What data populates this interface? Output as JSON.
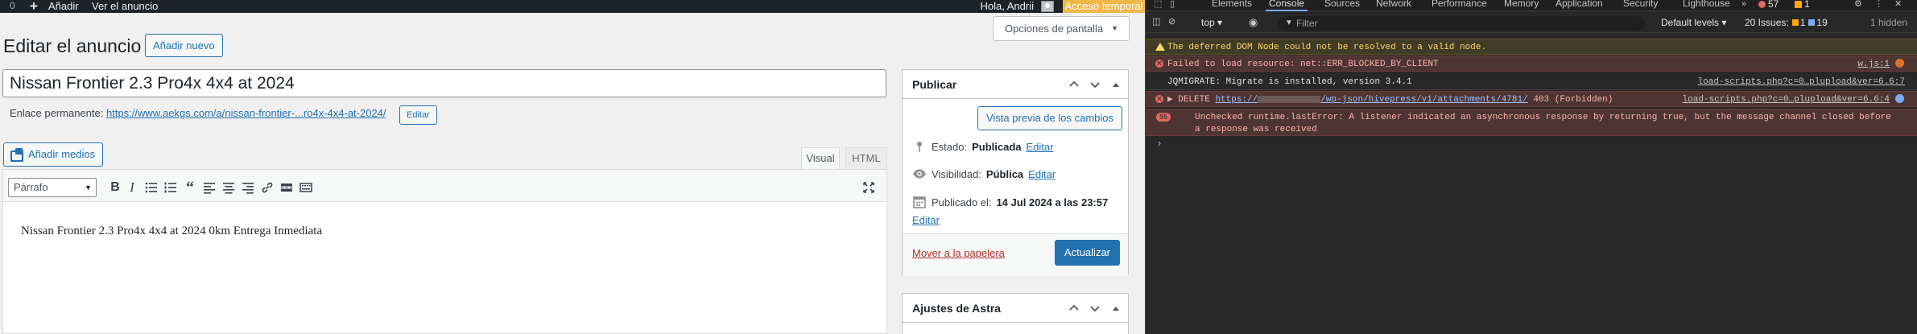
{
  "adminbar": {
    "count": "0",
    "new_label": "Añadir",
    "view_label": "Ver el anuncio",
    "howdy": "Hola, Andrii",
    "temp_access": "Acceso temporal"
  },
  "screen_options": "Opciones de pantalla",
  "page": {
    "title": "Editar el anuncio",
    "add_new": "Añadir nuevo",
    "post_title": "Nissan Frontier 2.3 Pro4x 4x4 at 2024",
    "permalink_label": "Enlace permanente:",
    "permalink_url": "https://www.aekgs.com/a/nissan-frontier-...ro4x-4x4-at-2024/",
    "permalink_edit": "Editar"
  },
  "editor": {
    "add_media": "Añadir medios",
    "tab_visual": "Visual",
    "tab_html": "HTML",
    "format": "Párrafo",
    "content": "Nissan Frontier 2.3 Pro4x 4x4 at 2024 0km Entrega Inmediata"
  },
  "publish": {
    "title": "Publicar",
    "preview": "Vista previa de los cambios",
    "status_label": "Estado:",
    "status_value": "Publicada",
    "visibility_label": "Visibilidad:",
    "visibility_value": "Pública",
    "published_label": "Publicado el:",
    "published_value": "14 Jul 2024 a las 23:57",
    "edit": "Editar",
    "trash": "Mover a la papelera",
    "update": "Actualizar"
  },
  "astra": {
    "title": "Ajustes de Astra"
  },
  "devtools": {
    "tabs": [
      "Elements",
      "Console",
      "Sources",
      "Network",
      "Performance",
      "Memory",
      "Application",
      "Security",
      "Lighthouse"
    ],
    "errors_count": "57",
    "warnings_count": "1",
    "context": "top",
    "filter_placeholder": "Filter",
    "levels": "Default levels",
    "issues_label": "20 Issues:",
    "issues_warn": "1",
    "issues_info": "19",
    "hidden": "1 hidden",
    "messages": [
      {
        "type": "warn",
        "text": "The deferred DOM Node could not be resolved to a valid node."
      },
      {
        "type": "err",
        "text": "Failed to load resource: net::ERR_BLOCKED_BY_CLIENT",
        "source": "w.js:1"
      },
      {
        "type": "log",
        "text": "JQMIGRATE: Migrate is installed, version 3.4.1",
        "source": "load-scripts.php?c=0…plupload&ver=6.6:7"
      },
      {
        "type": "err",
        "prefix": "▶ DELETE",
        "url_start": "https://",
        "url_end": "/wp-json/hivepress/v1/attachments/4781/",
        "status": "403 (Forbidden)",
        "source": "load-scripts.php?c=0…plupload&ver=6.6:4"
      },
      {
        "type": "err",
        "repeat": "55",
        "text": "Unchecked runtime.lastError: A listener indicated an asynchronous response by returning true, but the message channel closed before",
        "text2": "a response was received"
      }
    ]
  }
}
